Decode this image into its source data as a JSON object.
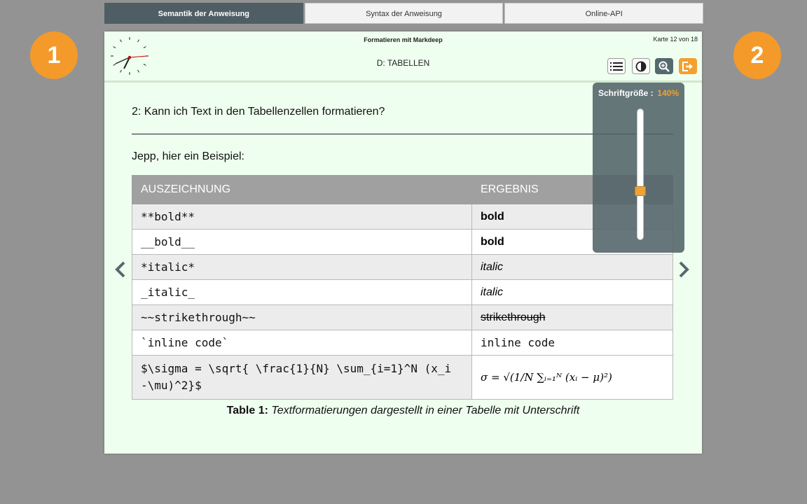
{
  "tabs": [
    {
      "label": "Semantik der Anweisung",
      "active": true
    },
    {
      "label": "Syntax der Anweisung",
      "active": false
    },
    {
      "label": "Online-API",
      "active": false
    }
  ],
  "badges": {
    "left": "1",
    "right": "2"
  },
  "card": {
    "title": "Formatieren mit Markdeep",
    "counter": "Karte 12 von 18",
    "section": "D: TABELLEN",
    "question": "2: Kann ich Text in den Tabellenzellen formatieren?",
    "answer": "Jepp, hier ein Beispiel:"
  },
  "table": {
    "headers": [
      "AUSZEICHNUNG",
      "ERGEBNIS"
    ],
    "rows": [
      {
        "markup": "**bold**",
        "result": "bold"
      },
      {
        "markup": "__bold__",
        "result": "bold"
      },
      {
        "markup": "*italic*",
        "result": "italic"
      },
      {
        "markup": "_italic_",
        "result": "italic"
      },
      {
        "markup": "~~strikethrough~~",
        "result": "strikethrough"
      },
      {
        "markup": "`inline code`",
        "result": "inline code"
      },
      {
        "markup_line1": "$\\sigma = \\sqrt{ \\frac{1}{N} \\sum_{i=1}^N (x_i",
        "markup_line2": "-\\mu)^2}$",
        "result": "σ = √(1/N ∑ᵢ₌₁ᴺ (xᵢ − μ)²)"
      }
    ],
    "caption_label": "Table 1:",
    "caption_text": "Textformatierungen dargestellt in einer Tabelle mit Unterschrift"
  },
  "font_panel": {
    "label": "Schriftgröße :",
    "value": "140%",
    "level_fraction": 0.36
  },
  "colors": {
    "accent": "#f49a2a",
    "active_tab": "#4f5e64",
    "card_bg": "#efffef"
  },
  "icons": [
    "clock-icon",
    "list-icon",
    "contrast-icon",
    "zoom-icon",
    "exit-icon",
    "chevron-left-icon",
    "chevron-right-icon"
  ]
}
